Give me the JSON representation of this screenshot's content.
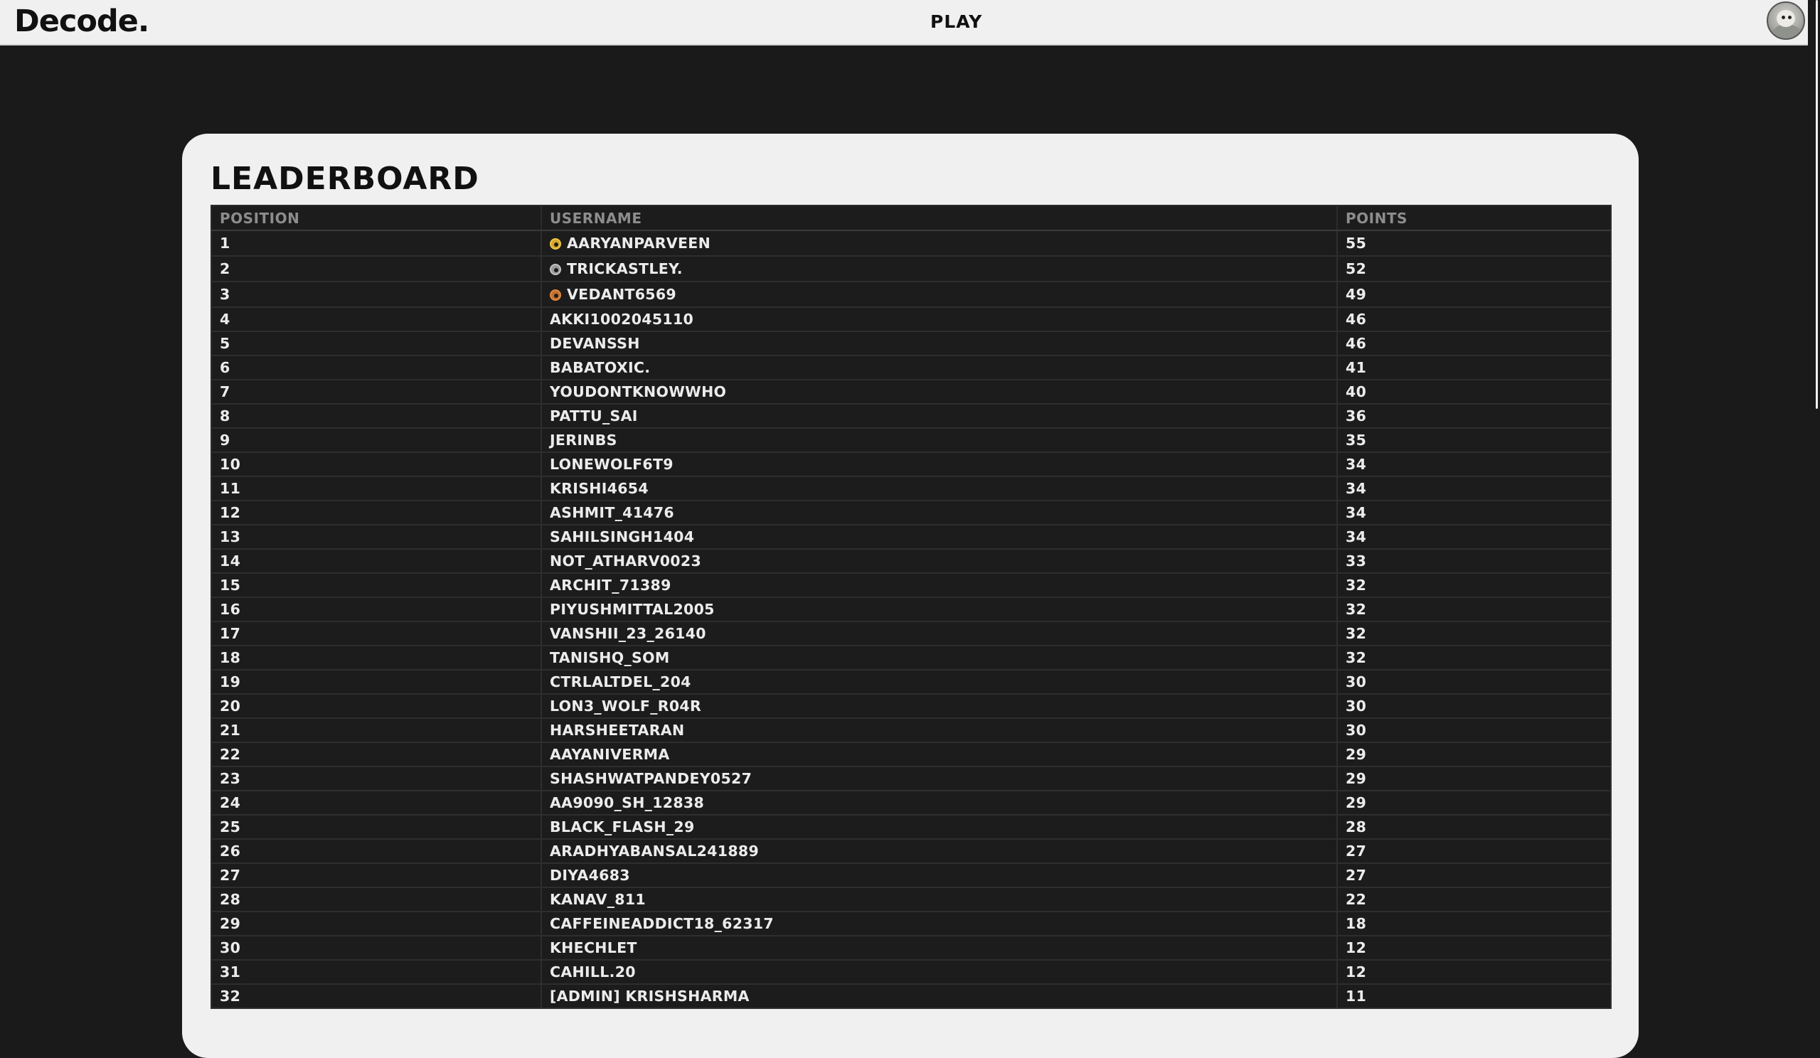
{
  "header": {
    "logo": "Decode.",
    "nav_play": "PLAY",
    "avatar_icon": "user-avatar"
  },
  "leaderboard": {
    "title": "LEADERBOARD",
    "columns": [
      "POSITION",
      "USERNAME",
      "POINTS"
    ],
    "medal_colors": {
      "gold": "#d4a72c",
      "silver": "#9a9a9a",
      "bronze": "#c4702e"
    },
    "rows": [
      {
        "position": "1",
        "username": "AARYANPARVEEN",
        "points": "55",
        "medal": "gold"
      },
      {
        "position": "2",
        "username": "TRICKASTLEY.",
        "points": "52",
        "medal": "silver"
      },
      {
        "position": "3",
        "username": "VEDANT6569",
        "points": "49",
        "medal": "bronze"
      },
      {
        "position": "4",
        "username": "AKKI1002045110",
        "points": "46"
      },
      {
        "position": "5",
        "username": "DEVANSSH",
        "points": "46"
      },
      {
        "position": "6",
        "username": "BABATOXIC.",
        "points": "41"
      },
      {
        "position": "7",
        "username": "YOUDONTKNOWWHO",
        "points": "40"
      },
      {
        "position": "8",
        "username": "PATTU_SAI",
        "points": "36"
      },
      {
        "position": "9",
        "username": "JERINBS",
        "points": "35"
      },
      {
        "position": "10",
        "username": "LONEWOLF6T9",
        "points": "34"
      },
      {
        "position": "11",
        "username": "KRISHI4654",
        "points": "34"
      },
      {
        "position": "12",
        "username": "ASHMIT_41476",
        "points": "34"
      },
      {
        "position": "13",
        "username": "SAHILSINGH1404",
        "points": "34"
      },
      {
        "position": "14",
        "username": "NOT_ATHARV0023",
        "points": "33"
      },
      {
        "position": "15",
        "username": "ARCHIT_71389",
        "points": "32"
      },
      {
        "position": "16",
        "username": "PIYUSHMITTAL2005",
        "points": "32"
      },
      {
        "position": "17",
        "username": "VANSHII_23_26140",
        "points": "32"
      },
      {
        "position": "18",
        "username": "TANISHQ_SOM",
        "points": "32"
      },
      {
        "position": "19",
        "username": "CTRLALTDEL_204",
        "points": "30"
      },
      {
        "position": "20",
        "username": "LON3_WOLF_R04R",
        "points": "30"
      },
      {
        "position": "21",
        "username": "HARSHEETARAN",
        "points": "30"
      },
      {
        "position": "22",
        "username": "AAYANIVERMA",
        "points": "29"
      },
      {
        "position": "23",
        "username": "SHASHWATPANDEY0527",
        "points": "29"
      },
      {
        "position": "24",
        "username": "AA9090_SH_12838",
        "points": "29"
      },
      {
        "position": "25",
        "username": "BLACK_FLASH_29",
        "points": "28"
      },
      {
        "position": "26",
        "username": "ARADHYABANSAL241889",
        "points": "27"
      },
      {
        "position": "27",
        "username": "DIYA4683",
        "points": "27"
      },
      {
        "position": "28",
        "username": "KANAV_811",
        "points": "22"
      },
      {
        "position": "29",
        "username": "CAFFEINEADDICT18_62317",
        "points": "18"
      },
      {
        "position": "30",
        "username": "KHECHLET",
        "points": "12"
      },
      {
        "position": "31",
        "username": "CAHILL.20",
        "points": "12"
      },
      {
        "position": "32",
        "username": "[ADMIN] KRISHSHARMA",
        "points": "11"
      }
    ]
  }
}
